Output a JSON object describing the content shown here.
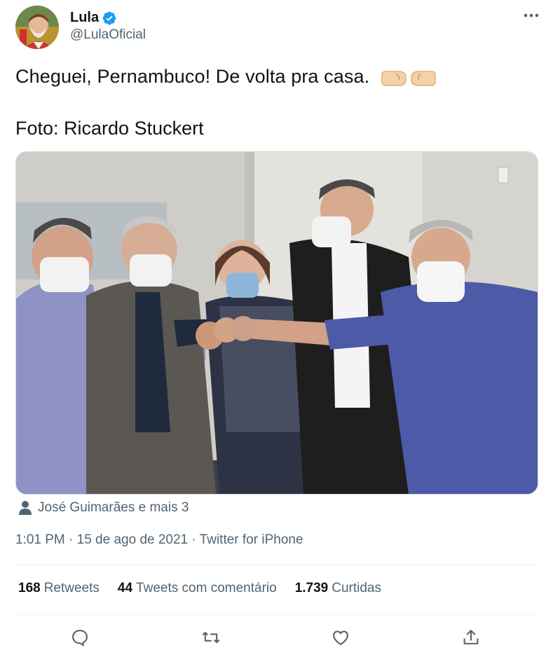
{
  "tweet": {
    "author": {
      "name": "Lula",
      "handle": "@LulaOficial",
      "verified": true
    },
    "text_line1": "Cheguei, Pernambuco! De volta pra casa.",
    "text_line2": "Foto: Ricardo Stuckert",
    "emoji": "fist-bump-emoji",
    "photo_alt": "Cinco pessoas de máscara fazendo um gesto de punhos unidos",
    "tagged": "José Guimarães e mais 3",
    "meta": "1:01 PM · 15 de ago de 2021 · Twitter for iPhone",
    "stats": [
      {
        "count": "168",
        "label": "Retweets"
      },
      {
        "count": "44",
        "label": "Tweets com comentário"
      },
      {
        "count": "1.739",
        "label": "Curtidas"
      }
    ],
    "actions": [
      "reply-icon",
      "retweet-icon",
      "like-icon",
      "share-icon"
    ]
  },
  "colors": {
    "text": "#0f1419",
    "secondary": "#536471",
    "verified": "#1d9bf0",
    "divider": "#eff3f4"
  }
}
